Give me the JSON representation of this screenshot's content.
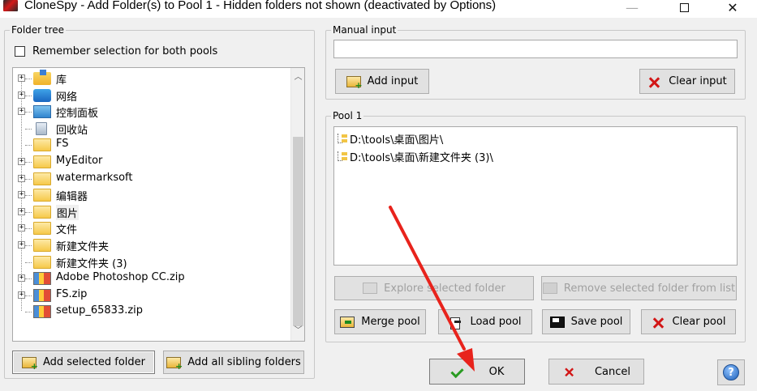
{
  "window": {
    "title": "CloneSpy - Add Folder(s) to Pool 1 - Hidden folders not shown (deactivated by Options)",
    "minimize": "—",
    "close": "✕"
  },
  "folder_tree": {
    "group_label": "Folder tree",
    "remember_label": "Remember selection for both pools",
    "remember_checked": false,
    "items": [
      {
        "label": "库",
        "icon": "library-icon",
        "expandable": true
      },
      {
        "label": "网络",
        "icon": "network-icon",
        "expandable": true
      },
      {
        "label": "控制面板",
        "icon": "control-panel-icon",
        "expandable": true
      },
      {
        "label": "回收站",
        "icon": "recycle-bin-icon",
        "expandable": false
      },
      {
        "label": "FS",
        "icon": "folder-icon",
        "expandable": false
      },
      {
        "label": "MyEditor",
        "icon": "folder-icon",
        "expandable": true
      },
      {
        "label": "watermarksoft",
        "icon": "folder-icon",
        "expandable": true
      },
      {
        "label": "编辑器",
        "icon": "folder-icon",
        "expandable": true
      },
      {
        "label": "图片",
        "icon": "folder-icon",
        "expandable": true,
        "selected": true
      },
      {
        "label": "文件",
        "icon": "folder-icon",
        "expandable": true
      },
      {
        "label": "新建文件夹",
        "icon": "folder-icon",
        "expandable": true
      },
      {
        "label": "新建文件夹 (3)",
        "icon": "folder-icon",
        "expandable": false
      },
      {
        "label": "Adobe Photoshop CC.zip",
        "icon": "zip-icon",
        "expandable": true
      },
      {
        "label": "FS.zip",
        "icon": "zip-icon",
        "expandable": true
      },
      {
        "label": "setup_65833.zip",
        "icon": "zip-icon",
        "expandable": false
      }
    ],
    "add_selected_label": "Add selected folder",
    "add_siblings_label": "Add all sibling folders"
  },
  "manual_input": {
    "group_label": "Manual input",
    "value": "",
    "add_label": "Add input",
    "clear_label": "Clear input"
  },
  "pool": {
    "group_label": "Pool 1",
    "entries": [
      "D:\\tools\\桌面\\图片\\",
      "D:\\tools\\桌面\\新建文件夹 (3)\\"
    ],
    "explore_label": "Explore selected folder",
    "remove_label": "Remove selected folder from list",
    "merge_label": "Merge pool",
    "load_label": "Load pool",
    "save_label": "Save pool",
    "clear_label": "Clear pool"
  },
  "footer": {
    "ok_label": "OK",
    "cancel_label": "Cancel",
    "help_label": "?"
  },
  "colors": {
    "annotation_arrow": "#e8231c",
    "clear_x": "#d21616",
    "ok_check": "#2a9b22"
  }
}
